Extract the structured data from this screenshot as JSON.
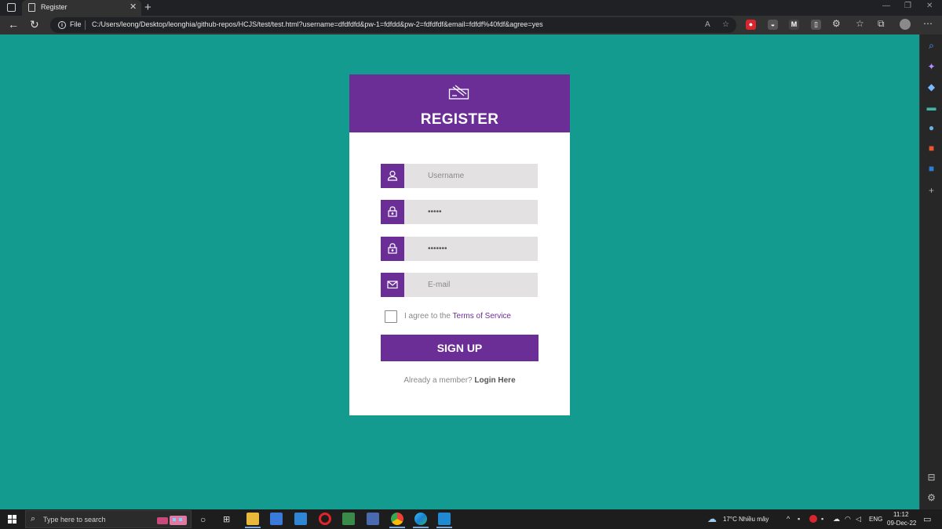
{
  "browser": {
    "tab_title": "Register",
    "tab_close": "✕",
    "new_tab": "+",
    "file_label": "File",
    "url": "C:/Users/leong/Desktop/leonghia/github-repos/HCJS/test/test.html?username=dfdfdfd&pw-1=fdfdd&pw-2=fdfdfdf&email=fdfdf%40fdf&agree=yes",
    "back_icon": "arrow-left-icon",
    "reload_icon": "refresh-icon",
    "menu_icon": "more-icon"
  },
  "register": {
    "title": "REGISTER",
    "username_placeholder": "Username",
    "password_value": "fdfdd",
    "confirm_password_value": "fdfdfdf",
    "email_placeholder": "E-mail",
    "agree_prefix": "I agree to the ",
    "terms_label": "Terms of Service",
    "signup_label": "SIGN UP",
    "member_prefix": "Already a member? ",
    "login_label": "Login Here"
  },
  "taskbar": {
    "search_placeholder": "Type here to search",
    "weather": "17°C  Nhiều mây",
    "language": "ENG",
    "time": "11:12",
    "date": "09-Dec-22"
  },
  "colors": {
    "page_background": "#139b8f",
    "accent": "#6a2e96",
    "input_background": "#e4e1e3"
  }
}
